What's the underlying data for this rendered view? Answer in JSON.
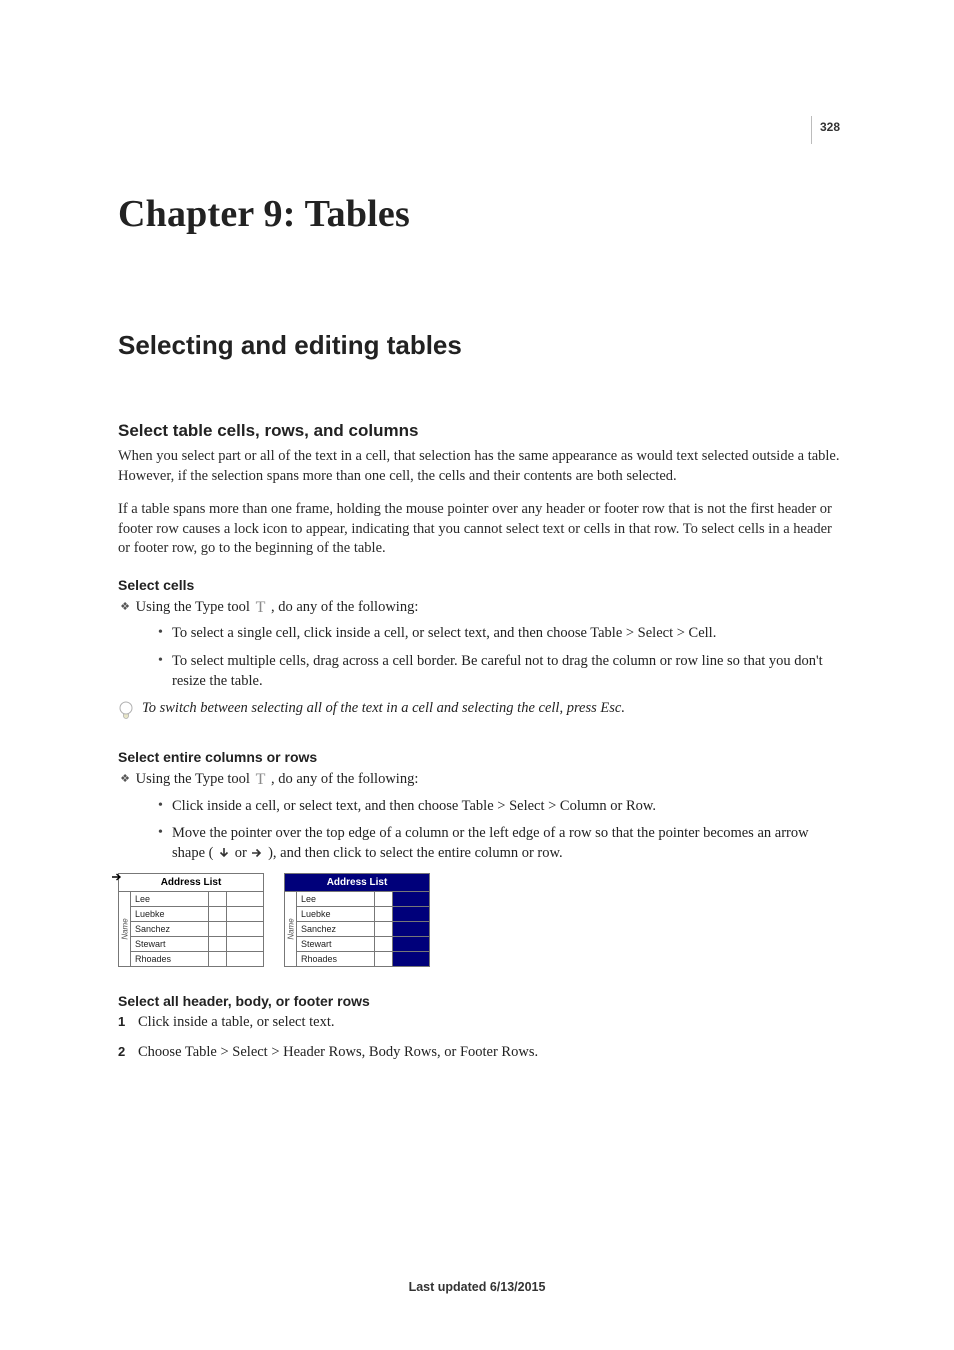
{
  "page_number": "328",
  "chapter_title": "Chapter 9: Tables",
  "section_title": "Selecting and editing tables",
  "topic1": {
    "heading": "Select table cells, rows, and columns",
    "p1": "When you select part or all of the text in a cell, that selection has the same appearance as would text selected outside a table. However, if the selection spans more than one cell, the cells and their contents are both selected.",
    "p2": "If a table spans more than one frame, holding the mouse pointer over any header or footer row that is not the first header or footer row causes a lock icon to appear, indicating that you cannot select text or cells in that row. To select cells in a header or footer row, go to the beginning of the table."
  },
  "select_cells": {
    "heading": "Select cells",
    "lead_a": "Using the Type tool ",
    "lead_b": " , do any of the following:",
    "b1": "To select a single cell, click inside a cell, or select text, and then choose Table > Select > Cell.",
    "b2": "To select multiple cells, drag across a cell border. Be careful not to drag the column or row line so that you don't resize the table.",
    "tip": "To switch between selecting all of the text in a cell and selecting the cell, press Esc."
  },
  "select_cols": {
    "heading": "Select entire columns or rows",
    "lead_a": "Using the Type tool ",
    "lead_b": " , do any of the following:",
    "b1": "Click inside a cell, or select text, and then choose Table > Select > Column or Row.",
    "b2_a": "Move the pointer over the top edge of a column or the left edge of a row so that the pointer becomes an arrow shape (",
    "b2_b": " or ",
    "b2_c": "), and then click to select the entire column or row."
  },
  "figure": {
    "header": "Address List",
    "side": "Name",
    "rows": [
      "Lee",
      "Luebke",
      "Sanchez",
      "Stewart",
      "Rhoades"
    ]
  },
  "select_all": {
    "heading": "Select all header, body, or footer rows",
    "s1": "Click inside a table, or select text.",
    "s2": "Choose Table > Select > Header Rows, Body Rows, or Footer Rows."
  },
  "footer": "Last updated 6/13/2015"
}
